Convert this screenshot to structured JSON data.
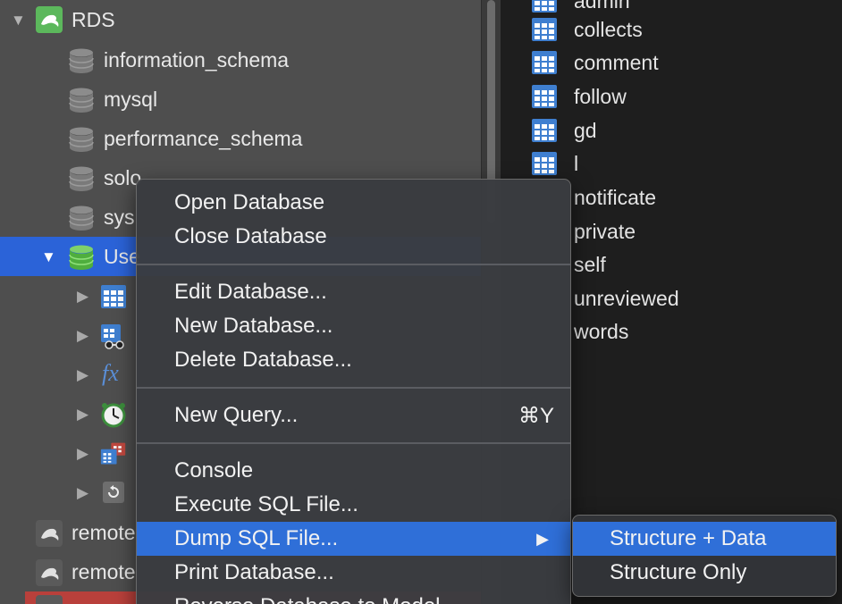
{
  "sidebar": {
    "connection": {
      "label": "RDS"
    },
    "databases": [
      {
        "label": "information_schema"
      },
      {
        "label": "mysql"
      },
      {
        "label": "performance_schema"
      },
      {
        "label": "solo"
      },
      {
        "label": "sys"
      },
      {
        "label": "Use"
      }
    ],
    "other_connections": [
      {
        "label": "remote"
      },
      {
        "label": "remote"
      }
    ]
  },
  "tables": [
    {
      "label": "admin"
    },
    {
      "label": "collects"
    },
    {
      "label": "comment"
    },
    {
      "label": "follow"
    },
    {
      "label": "gd"
    },
    {
      "label": "l"
    },
    {
      "label": "notificate"
    },
    {
      "label": "private"
    },
    {
      "label": "self"
    },
    {
      "label": "unreviewed"
    },
    {
      "label": "words"
    }
  ],
  "context_menu": {
    "open_database": "Open Database",
    "close_database": "Close Database",
    "edit_database": "Edit Database...",
    "new_database": "New Database...",
    "delete_database": "Delete Database...",
    "new_query": "New Query...",
    "new_query_shortcut": "⌘Y",
    "console": "Console",
    "execute_sql_file": "Execute SQL File...",
    "dump_sql_file": "Dump SQL File...",
    "print_database": "Print Database...",
    "reverse_database": "Reverse Database to Model"
  },
  "submenu": {
    "structure_data": "Structure + Data",
    "structure_only": "Structure Only"
  },
  "colors": {
    "selection": "#2b63d8",
    "menu_highlight": "#2f6fd8",
    "sidebar_bg": "#4e4e4e",
    "panel_bg": "#1e1e1e",
    "connection_icon": "#5cb85c",
    "remote_row": "#b9403b"
  }
}
